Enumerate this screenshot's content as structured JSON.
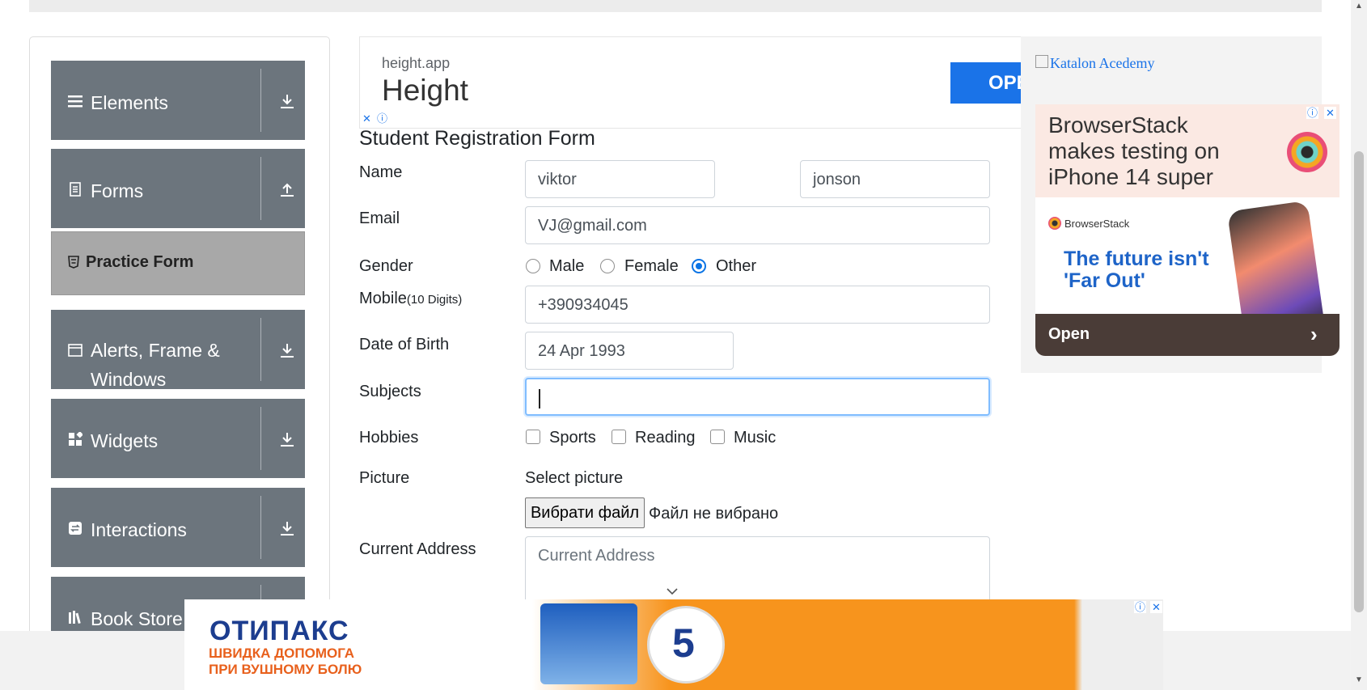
{
  "sidebar": {
    "groups": [
      {
        "label": "Elements",
        "icon": "list-icon",
        "state": "collapsed"
      },
      {
        "label": "Forms",
        "icon": "document-icon",
        "state": "expanded"
      },
      {
        "label": "Alerts, Frame & Windows",
        "icon": "window-icon",
        "state": "collapsed"
      },
      {
        "label": "Widgets",
        "icon": "widgets-icon",
        "state": "collapsed"
      },
      {
        "label": "Interactions",
        "icon": "interactions-icon",
        "state": "collapsed"
      },
      {
        "label": "Book Store",
        "icon": "books-icon",
        "state": "collapsed"
      }
    ],
    "active_item": {
      "label": "Practice Form",
      "icon": "html5-icon"
    }
  },
  "top_ad": {
    "domain": "height.app",
    "title": "Height",
    "button": "OPE"
  },
  "form": {
    "title": "Student Registration Form",
    "name_label": "Name",
    "first_name": "viktor",
    "last_name": "jonson",
    "email_label": "Email",
    "email": "VJ@gmail.com",
    "gender_label": "Gender",
    "gender_options": [
      "Male",
      "Female",
      "Other"
    ],
    "gender_selected": "Other",
    "mobile_label": "Mobile",
    "mobile_hint": "(10 Digits)",
    "mobile": "+390934045",
    "dob_label": "Date of Birth",
    "dob": "24 Apr 1993",
    "subjects_label": "Subjects",
    "subjects": "",
    "hobbies_label": "Hobbies",
    "hobbies": [
      "Sports",
      "Reading",
      "Music"
    ],
    "picture_label": "Picture",
    "picture_prompt": "Select picture",
    "file_button": "Вибрати файл",
    "file_status": "Файл не вибрано",
    "address_label": "Current Address",
    "address_placeholder": "Current Address"
  },
  "right_ad": {
    "broken_image_alt": "Katalon Acedemy",
    "headline": "BrowserStack makes testing on iPhone 14 super",
    "brand": "BrowserStack",
    "tagline": "The future isn't 'Far Out'",
    "cta": "Open"
  },
  "bottom_ad": {
    "brand": "ОТИПАКС",
    "subtitle": "ШВИДКА ДОПОМОГА ПРИ ВУШНОМУ БОЛЮ",
    "badge": "5"
  },
  "colors": {
    "sidebar_group_bg": "#6c757d",
    "active_item_bg": "#a8a8a8",
    "focus_blue": "#80bdff",
    "radio_blue": "#0b74e5",
    "ad_button_blue": "#1a73e8"
  }
}
